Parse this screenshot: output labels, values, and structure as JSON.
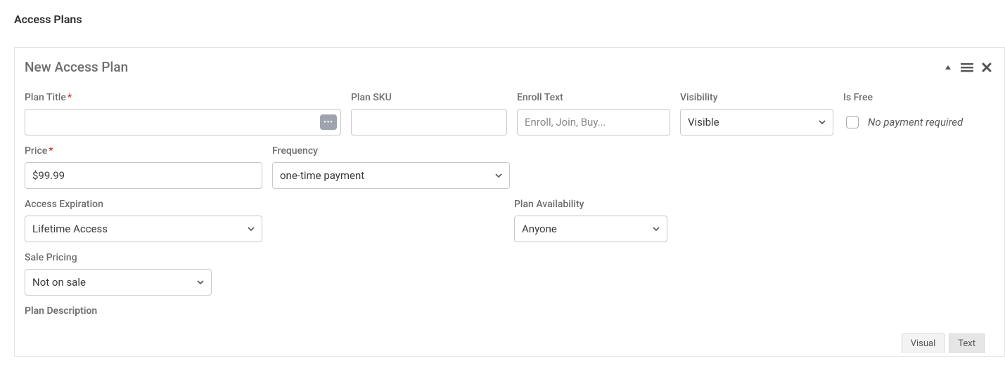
{
  "section_title": "Access Plans",
  "panel": {
    "title": "New Access Plan"
  },
  "toolbar": {
    "collapse": "▲"
  },
  "labels": {
    "plan_title": "Plan Title",
    "plan_sku": "Plan SKU",
    "enroll_text": "Enroll Text",
    "visibility": "Visibility",
    "is_free": "Is Free",
    "is_free_hint": "No payment required",
    "price": "Price",
    "frequency": "Frequency",
    "access_expiration": "Access Expiration",
    "plan_availability": "Plan Availability",
    "sale_pricing": "Sale Pricing",
    "plan_description": "Plan Description"
  },
  "values": {
    "plan_title": "",
    "plan_sku": "",
    "enroll_text_placeholder": "Enroll, Join, Buy...",
    "visibility": "Visible",
    "price": "$99.99",
    "frequency": "one-time payment",
    "access_expiration": "Lifetime Access",
    "plan_availability": "Anyone",
    "sale_pricing": "Not on sale"
  },
  "editor_tabs": {
    "visual": "Visual",
    "text": "Text"
  }
}
